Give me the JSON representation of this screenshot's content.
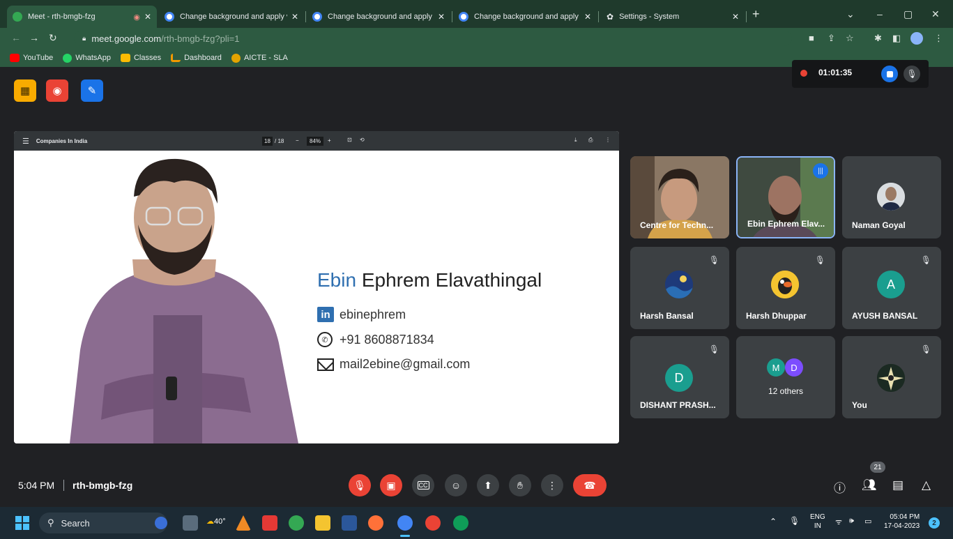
{
  "tabs": [
    {
      "title": "Meet - rth-bmgb-fzg",
      "active": true
    },
    {
      "title": "Change background and apply v",
      "active": false
    },
    {
      "title": "Change background and apply v",
      "active": false
    },
    {
      "title": "Change background and apply v",
      "active": false
    },
    {
      "title": "Settings - System",
      "active": false
    }
  ],
  "new_tab_label": "+",
  "address": {
    "host": "meet.google.com",
    "path": "/rth-bmgb-fzg?pli=1"
  },
  "bookmarks": [
    "YouTube",
    "WhatsApp",
    "Classes",
    "Dashboard",
    "AICTE - SLA"
  ],
  "recording": {
    "time": "01:01:35"
  },
  "pdf": {
    "title": "Companies In India",
    "page": "18",
    "pages": "/ 18",
    "zoom": "84%"
  },
  "slide": {
    "first_name": "Ebin",
    "rest_name": "Ephrem Elavathingal",
    "linkedin": "ebinephrem",
    "phone": "+91 8608871834",
    "email": "mail2ebine@gmail.com"
  },
  "participants": [
    {
      "name": "Centre for Techn...",
      "type": "video"
    },
    {
      "name": "Ebin Ephrem Elav...",
      "type": "video",
      "speaking": true
    },
    {
      "name": "Naman Goyal",
      "type": "photo"
    },
    {
      "name": "Harsh Bansal",
      "type": "photo",
      "muted": true
    },
    {
      "name": "Harsh Dhuppar",
      "type": "photo",
      "muted": true
    },
    {
      "name": "AYUSH BANSAL",
      "type": "letter",
      "letter": "A",
      "color": "#1a9e8f",
      "muted": true
    },
    {
      "name": "DISHANT PRASH...",
      "type": "letter",
      "letter": "D",
      "color": "#1a9e8f",
      "muted": true
    },
    {
      "name": "12 others",
      "type": "others",
      "letters": [
        "M",
        "D"
      ]
    },
    {
      "name": "You",
      "type": "photo",
      "muted": true
    }
  ],
  "meeting": {
    "time": "5:04 PM",
    "code": "rth-bmgb-fzg",
    "people_count": "21"
  },
  "taskbar": {
    "search_label": "Search",
    "weather": "40°",
    "lang": "ENG",
    "region": "IN",
    "clock_time": "05:04 PM",
    "clock_date": "17-04-2023",
    "notif_count": "2"
  },
  "colors": {
    "meet_bg": "#202124",
    "tile_bg": "#3c4043",
    "red": "#ea4335",
    "chrome_green": "#2d5a41",
    "linkedin_blue": "#2f6fb0"
  }
}
